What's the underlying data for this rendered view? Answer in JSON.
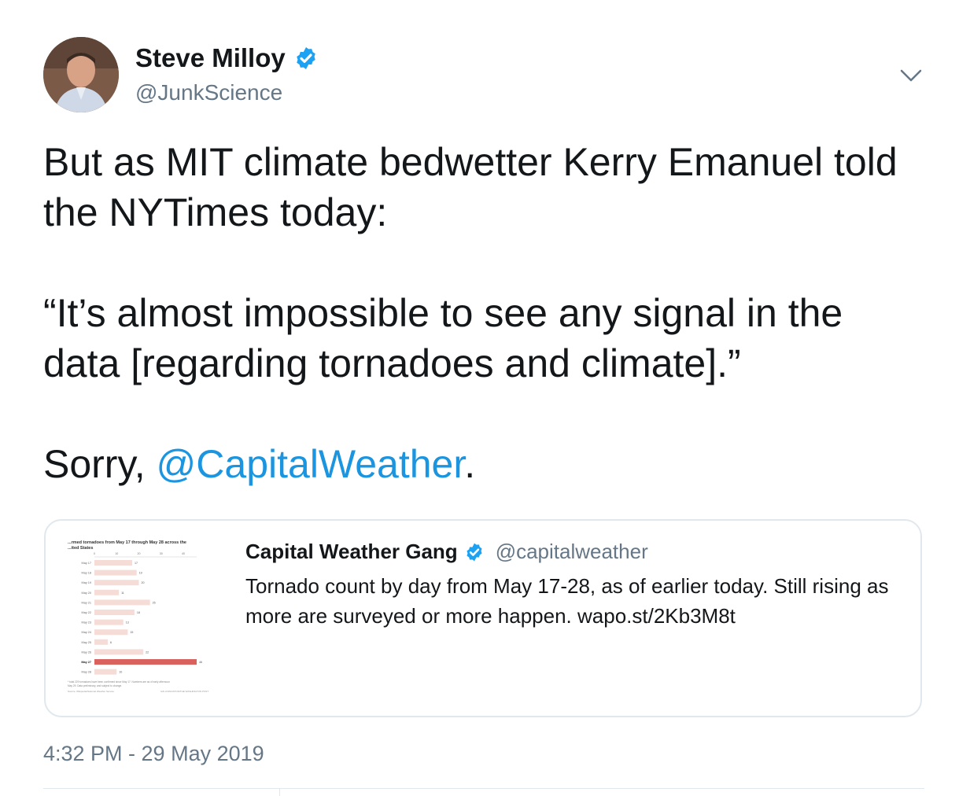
{
  "author": {
    "name": "Steve Milloy",
    "handle": "@JunkScience",
    "verified": true
  },
  "tweet": {
    "line1": "But as MIT climate bedwetter Kerry Emanuel told the NYTimes today:",
    "line2": "“It’s almost impossible to see any signal in the data [regarding tornadoes and climate].”",
    "line3_prefix": "Sorry, ",
    "line3_mention": "@CapitalWeather",
    "line3_suffix": "."
  },
  "quoted": {
    "name": "Capital Weather Gang",
    "handle": "@capitalweather",
    "verified": true,
    "text": "Tornado count by day from May 17-28, as of earlier today. Still rising as more are surveyed or more happen. wapo.st/2Kb3M8t",
    "thumbnail": {
      "title_line1": "...rmed tornadoes from May 17 through May 28 across the",
      "title_line2": "...ited States",
      "axis_ticks": [
        "0",
        "10",
        "20",
        "30",
        "40"
      ],
      "footnote_line1": "* total 229 tornadoes have been confirmed since May 17. Numbers are as of early afternoon",
      "footnote_line2": "May 29. Data preliminary, and subject to change.",
      "source_left": "Source: Wikipedia/National Weather Service",
      "source_right": "IAN LIVINGSTON/THE WASHINGTON POST",
      "accent": "#d9625f",
      "bar_color": "#f6dcd6"
    }
  },
  "chart_data": {
    "type": "bar",
    "orientation": "horizontal",
    "title": "...rmed tornadoes from May 17 through May 28 across the ...ited States",
    "categories": [
      "May 17",
      "May 18",
      "May 19",
      "May 20",
      "May 21",
      "May 22",
      "May 23",
      "May 24",
      "May 25",
      "May 26",
      "May 27",
      "May 28"
    ],
    "values": [
      17,
      19,
      20,
      11,
      25,
      18,
      13,
      15,
      6,
      22,
      46,
      10
    ],
    "highlight": "May 27",
    "xlim": [
      0,
      46
    ]
  },
  "timestamp": "4:32 PM - 29 May 2019",
  "colors": {
    "link": "#1b95e0",
    "verified": "#1da1f2",
    "muted": "#657786"
  }
}
